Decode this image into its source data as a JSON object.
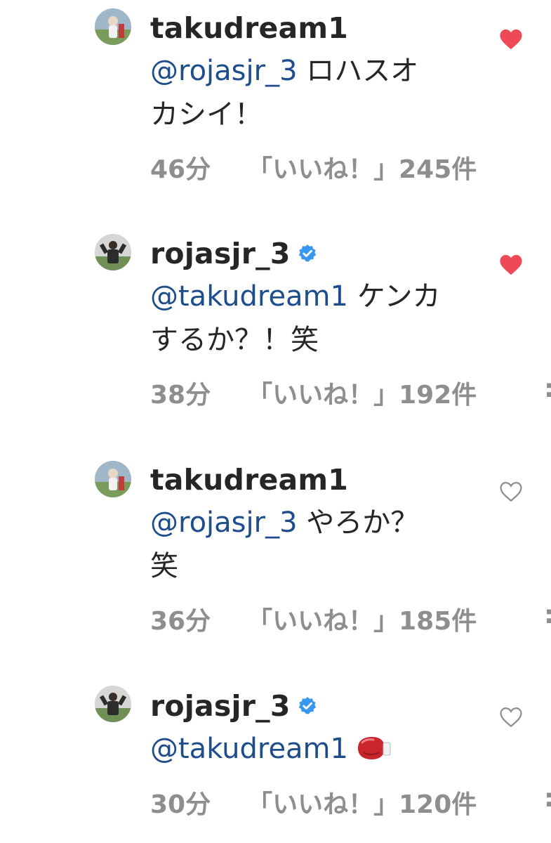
{
  "comments": [
    {
      "username": "takudream1",
      "verified": false,
      "mention": "@rojasjr_3",
      "text": " ロハスオカシイ！",
      "time": "46分",
      "likes": "「いいね！」245件",
      "liked": true
    },
    {
      "username": "rojasjr_3",
      "verified": true,
      "mention": "@takudream1",
      "text": " ケンカするか？！笑",
      "time": "38分",
      "likes": "「いいね！」192件",
      "liked": true
    },
    {
      "username": "takudream1",
      "verified": false,
      "mention": "@rojasjr_3",
      "text": " やろか？笑",
      "time": "36分",
      "likes": "「いいね！」185件",
      "liked": false
    },
    {
      "username": "rojasjr_3",
      "verified": true,
      "mention": "@takudream1",
      "text": "",
      "emoji": "boxing-glove-icon",
      "time": "30分",
      "likes": "「いいね！」120件",
      "liked": false
    }
  ],
  "colors": {
    "mention": "#1d4d8b",
    "liked_heart": "#ed4956",
    "meta": "#8e8e8e",
    "verified": "#3897f0"
  }
}
